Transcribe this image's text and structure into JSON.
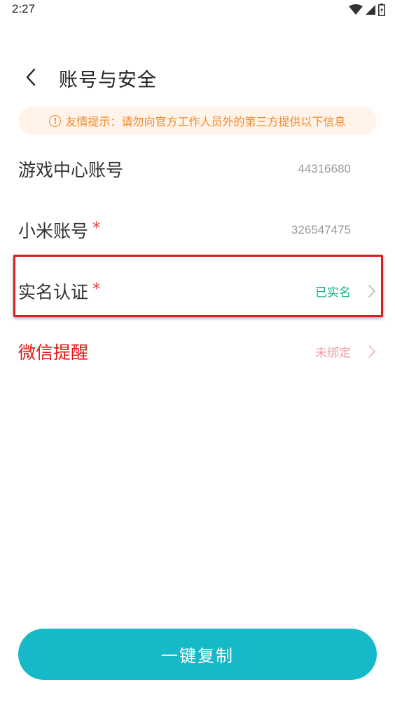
{
  "status_bar": {
    "time": "2:27",
    "icons": [
      "wifi-icon",
      "signal-icon",
      "battery-icon"
    ]
  },
  "header": {
    "back_icon": "chevron-left-icon",
    "title": "账号与安全"
  },
  "notice": {
    "icon": "info-circle-icon",
    "text": "友情提示：请勿向官方工作人员外的第三方提供以下信息",
    "color": "#f08a2c",
    "background": "#fff3ea"
  },
  "rows": [
    {
      "label": "游戏中心账号",
      "value": "44316680",
      "required": false,
      "has_arrow": false
    },
    {
      "label": "小米账号",
      "value": "326547475",
      "required": true,
      "required_mark": "*",
      "has_arrow": false
    },
    {
      "label": "实名认证",
      "value": "已实名",
      "required": true,
      "required_mark": "*",
      "has_arrow": true,
      "value_color": "#1bb38a"
    },
    {
      "label": "微信提醒",
      "value": "未绑定",
      "required": false,
      "has_arrow": true,
      "label_color": "#e21818",
      "value_color": "#f39aa0"
    }
  ],
  "copy_button": {
    "label": "一键复制",
    "color": "#15b9c7"
  },
  "highlight_color": "#d62020"
}
